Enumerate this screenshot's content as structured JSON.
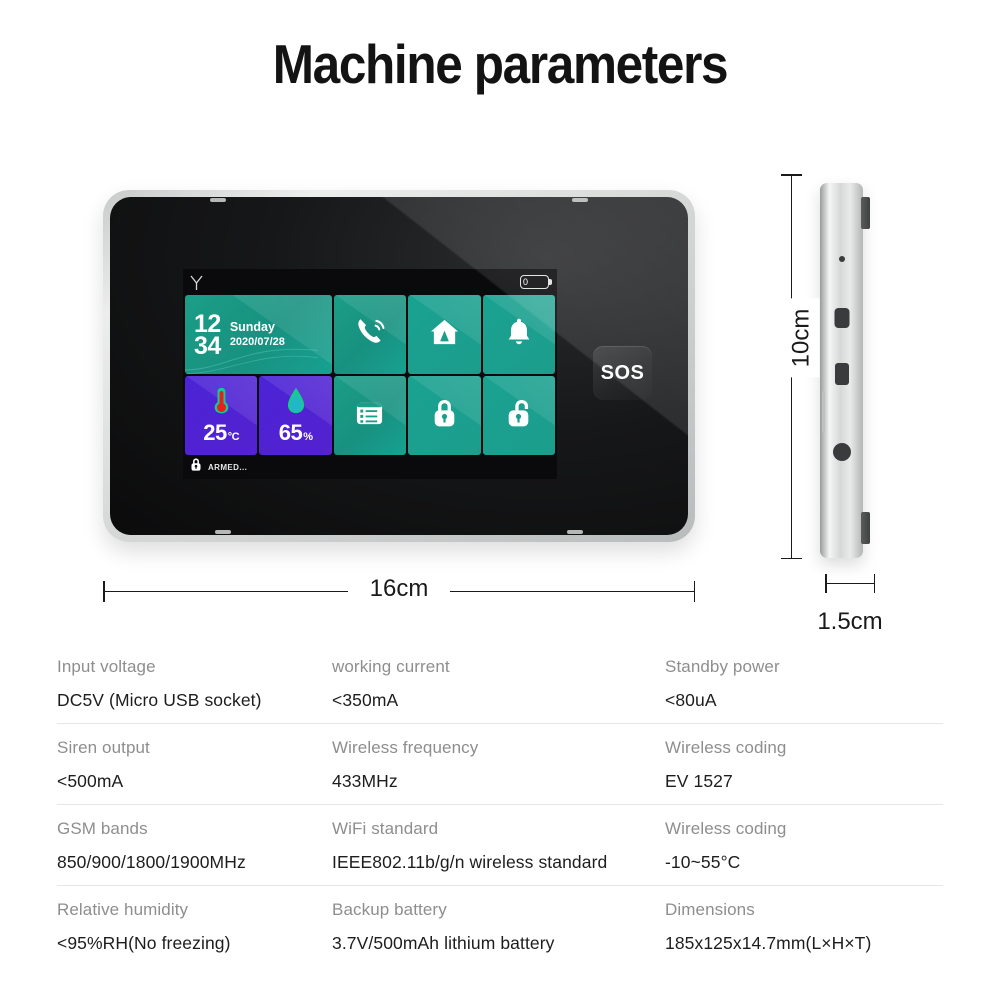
{
  "title": "Machine parameters",
  "device": {
    "screen": {
      "status_bar": {
        "signal_icon": "antenna-icon",
        "battery_icon": "battery-icon",
        "battery_level": "0"
      },
      "clock_tile": {
        "hours": "12",
        "minutes": "34",
        "day": "Sunday",
        "date": "2020/07/28"
      },
      "tiles": [
        {
          "name": "call-tile",
          "icon": "phone-icon",
          "color": "teal"
        },
        {
          "name": "home-arm-tile",
          "icon": "house-icon",
          "color": "teal"
        },
        {
          "name": "alarm-bell-tile",
          "icon": "bell-icon",
          "color": "teal"
        },
        {
          "name": "temperature-tile",
          "icon": "thermometer-icon",
          "color": "purple",
          "value": "25",
          "unit": "°C"
        },
        {
          "name": "humidity-tile",
          "icon": "water-drop-icon",
          "color": "purple",
          "value": "65",
          "unit": "%"
        },
        {
          "name": "menu-tile",
          "icon": "list-icon",
          "color": "teal"
        },
        {
          "name": "arm-tile",
          "icon": "lock-closed-icon",
          "color": "teal"
        },
        {
          "name": "disarm-tile",
          "icon": "lock-open-icon",
          "color": "teal"
        }
      ],
      "footer": {
        "lock_icon": "lock-closed-icon",
        "status_text": "ARMED..."
      }
    },
    "sos_label": "SOS"
  },
  "dimensions": {
    "width_label": "16cm",
    "height_label": "10cm",
    "thickness_label": "1.5cm"
  },
  "specs": {
    "rows": [
      [
        {
          "label": "Input voltage",
          "value": "DC5V (Micro USB socket)"
        },
        {
          "label": "working current",
          "value": "<350mA"
        },
        {
          "label": "Standby power",
          "value": "<80uA"
        }
      ],
      [
        {
          "label": "Siren output",
          "value": "<500mA"
        },
        {
          "label": "Wireless frequency",
          "value": "433MHz"
        },
        {
          "label": "Wireless coding",
          "value": "EV 1527"
        }
      ],
      [
        {
          "label": "GSM bands",
          "value": "850/900/1800/1900MHz"
        },
        {
          "label": "WiFi standard",
          "value": "IEEE802.11b/g/n wireless standard"
        },
        {
          "label": "Wireless coding",
          "value": "-10~55°C"
        }
      ],
      [
        {
          "label": "Relative humidity",
          "value": "<95%RH(No freezing)"
        },
        {
          "label": "Backup battery",
          "value": "3.7V/500mAh lithium battery"
        },
        {
          "label": "Dimensions",
          "value": "185x125x14.7mm(L×H×T)"
        }
      ]
    ]
  },
  "colors": {
    "teal": "#1b9e87",
    "purple": "#4b23d6",
    "label_gray": "#8e8e8e",
    "value_dark": "#1d1d1d"
  }
}
